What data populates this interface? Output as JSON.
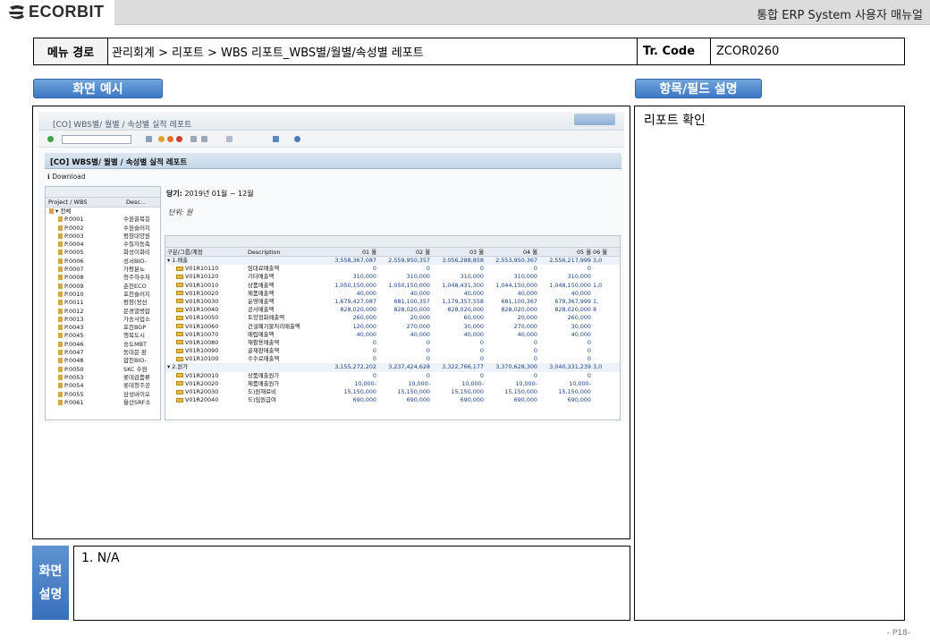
{
  "header": {
    "logo_text": "ECORBIT",
    "manual_title": "통합 ERP System 사용자 매뉴얼"
  },
  "meta": {
    "menu_label": "메뉴 경로",
    "menu_path": "관리회계 > 리포트 > WBS 리포트_WBS별/월별/속성별 레포트",
    "tr_label": "Tr. Code",
    "tr_code": "ZCOR0260"
  },
  "sections": {
    "screen_example": "화면 예시",
    "field_desc": "항목/필드 설명",
    "field_desc_text": "리포트 확인",
    "desc_label_1": "화면",
    "desc_label_2": "설명",
    "desc_text": "1.   N/A"
  },
  "page_no": "- P18-",
  "sap": {
    "window_title": "[CO] WBS별/ 월별 / 속성별 실적 레포트",
    "report_title": "[CO] WBS별/ 월별 / 속성별 실적 레포트",
    "download": "Download",
    "period_label": "당기:",
    "period_value": "2019년 01월 ~ 12월",
    "unit": "단위: 원",
    "tree_cols": [
      "Project / WBS",
      "Desc..."
    ],
    "tree_rows": [
      [
        "▾ 전체",
        ""
      ],
      [
        "P.0001",
        "수원골목길"
      ],
      [
        "P.0002",
        "수원슬러지"
      ],
      [
        "P.0003",
        "평창대양원"
      ],
      [
        "P.0004",
        "수질자동측"
      ],
      [
        "P.0005",
        "화성이화리"
      ],
      [
        "P.0006",
        "성서BIO-"
      ],
      [
        "P.0007",
        "가평분뇨"
      ],
      [
        "P.0008",
        "청주하수처"
      ],
      [
        "P.0009",
        "춘천ECO"
      ],
      [
        "P.0010",
        "포천슬러지"
      ],
      [
        "P.0011",
        "평창(정선"
      ],
      [
        "P.0012",
        "문경열병합"
      ],
      [
        "P.0013",
        "가송사업소"
      ],
      [
        "P.0043",
        "포천BGP"
      ],
      [
        "P.0045",
        "행복도시"
      ],
      [
        "P.0046",
        "송도MBT"
      ],
      [
        "P.0047",
        "동대문 환"
      ],
      [
        "P.0048",
        "합천BIO-"
      ],
      [
        "P.0050",
        "SKC 수원"
      ],
      [
        "P.0053",
        "롯데감품류"
      ],
      [
        "P.0054",
        "롯데청주공"
      ],
      [
        "P.0055",
        "삼성바이오"
      ],
      [
        "P.0061",
        "울산SRF소"
      ]
    ],
    "grid_cols": [
      "구분/그룹/계정",
      "Description",
      "01 월",
      "02 월",
      "03 월",
      "04 월",
      "05 월",
      "06 월"
    ],
    "grid_rows": [
      {
        "type": "sum",
        "a": "▾ 1.매출",
        "b": "",
        "v": [
          "3,558,367,087",
          "2,559,950,357",
          "3,056,288,858",
          "2,553,950,367",
          "2,556,217,999",
          "3,0"
        ]
      },
      {
        "a": "V01R10110",
        "b": "임대료매출액",
        "v": [
          "0",
          "0",
          "0",
          "0",
          "0",
          ""
        ]
      },
      {
        "a": "V01R10120",
        "b": "기타매출액",
        "v": [
          "310,000",
          "310,000",
          "310,000",
          "310,000",
          "310,000",
          ""
        ]
      },
      {
        "a": "V01R10010",
        "b": "상품매출액",
        "v": [
          "1,050,150,000",
          "1,050,150,000",
          "1,048,431,300",
          "1,044,150,000",
          "1,048,150,000",
          "1,0"
        ]
      },
      {
        "a": "V01R10020",
        "b": "제품매출액",
        "v": [
          "40,000",
          "40,000",
          "40,000",
          "40,000",
          "40,000",
          ""
        ]
      },
      {
        "a": "V01R10030",
        "b": "운영매출액",
        "v": [
          "1,679,427,087",
          "681,100,357",
          "1,179,357,558",
          "681,100,367",
          "679,367,999",
          "1,"
        ]
      },
      {
        "a": "V01R10040",
        "b": "공사매출액",
        "v": [
          "828,020,000",
          "828,020,000",
          "828,020,000",
          "828,020,000",
          "828,020,000",
          "8"
        ]
      },
      {
        "a": "V01R10050",
        "b": "토양정화매출액",
        "v": [
          "260,000",
          "20,000",
          "60,000",
          "20,000",
          "260,000",
          ""
        ]
      },
      {
        "a": "V01R10060",
        "b": "건설폐기물처리매출액",
        "v": [
          "120,000",
          "270,000",
          "30,000",
          "270,000",
          "30,000",
          ""
        ]
      },
      {
        "a": "V01R10070",
        "b": "매립매출액",
        "v": [
          "40,000",
          "40,000",
          "40,000",
          "40,000",
          "40,000",
          ""
        ]
      },
      {
        "a": "V01R10080",
        "b": "재활용매출액",
        "v": [
          "0",
          "0",
          "0",
          "0",
          "0",
          ""
        ]
      },
      {
        "a": "V01R10090",
        "b": "골재판매출액",
        "v": [
          "0",
          "0",
          "0",
          "0",
          "0",
          ""
        ]
      },
      {
        "a": "V01R10100",
        "b": "수수료매출액",
        "v": [
          "0",
          "0",
          "0",
          "0",
          "0",
          ""
        ]
      },
      {
        "type": "sum",
        "a": "▾ 2.원가",
        "b": "",
        "v": [
          "3,155,272,202",
          "3,237,424,628",
          "3,322,766,177",
          "3,370,628,300",
          "3,040,331,239",
          "3,0"
        ]
      },
      {
        "a": "V01R20010",
        "b": "상품매출원가",
        "v": [
          "0",
          "0",
          "0",
          "0",
          "0",
          ""
        ]
      },
      {
        "a": "V01R20020",
        "b": "제품매출원가",
        "v": [
          "10,000-",
          "10,000-",
          "10,000-",
          "10,000-",
          "10,000-",
          ""
        ]
      },
      {
        "a": "V01R20030",
        "b": "도)원재료비",
        "v": [
          "15,150,000",
          "15,150,000",
          "15,150,000",
          "15,150,000",
          "15,150,000",
          ""
        ]
      },
      {
        "a": "V01R20040",
        "b": "도)임원급여",
        "v": [
          "690,000",
          "690,000",
          "690,000",
          "690,000",
          "690,000",
          ""
        ]
      }
    ]
  }
}
